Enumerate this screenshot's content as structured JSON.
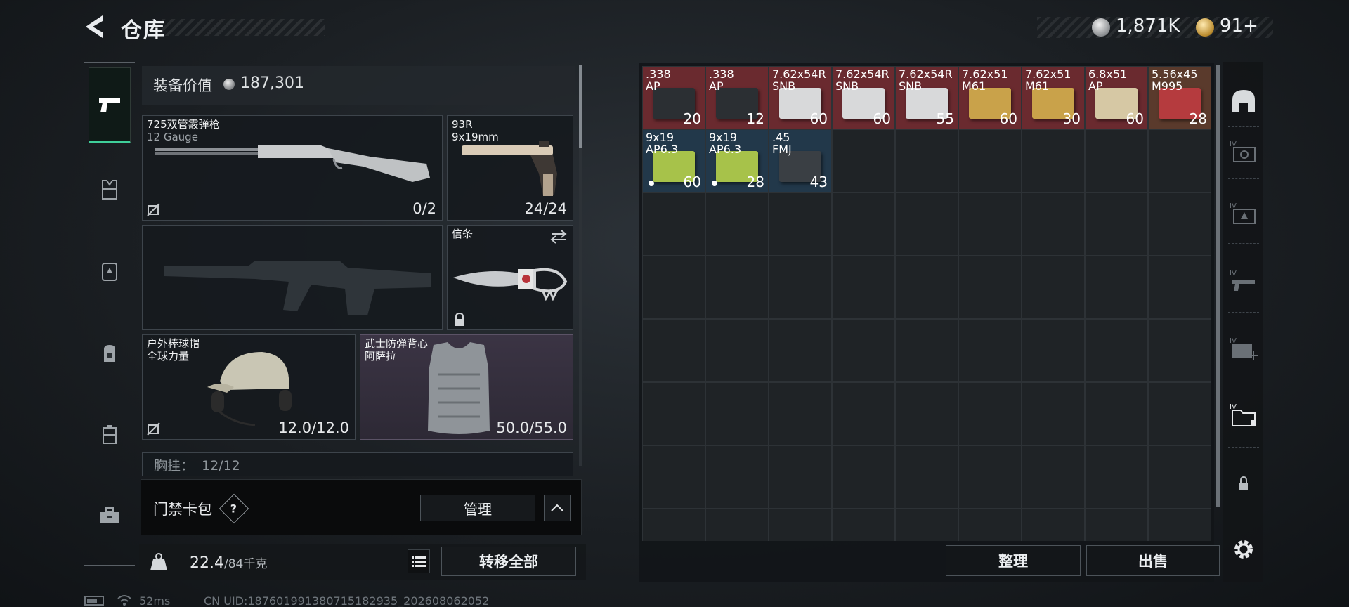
{
  "header": {
    "title": "仓库",
    "silver_amount": "1,871K",
    "gold_amount": "91+"
  },
  "loadout": {
    "equip_value_label": "装备价值",
    "equip_value": "187,301",
    "primary": {
      "name": "725双管霰弹枪",
      "caliber": "12 Gauge",
      "ammo": "0/2"
    },
    "sidearm": {
      "name": "93R",
      "caliber": "9x19mm",
      "ammo": "24/24"
    },
    "melee": {
      "name": "信条"
    },
    "helmet": {
      "name": "户外棒球帽",
      "brand": "全球力量",
      "durability": "12.0/12.0"
    },
    "armor": {
      "name": "武士防弹背心",
      "brand": "阿萨拉",
      "durability": "50.0/55.0"
    },
    "chest_rig": {
      "label": "胸挂：",
      "value": "12/12"
    }
  },
  "keycard": {
    "label": "门禁卡包",
    "help": "?",
    "manage_label": "管理"
  },
  "weight": {
    "current": "22.4",
    "max": "/84千克",
    "transfer_all_label": "转移全部"
  },
  "storage": {
    "items": [
      {
        "name": ".338\nAP",
        "count": "20",
        "bg": "#6a2a2f",
        "box": "#2b2f33",
        "dot": false
      },
      {
        "name": ".338\nAP",
        "count": "12",
        "bg": "#6a2a2f",
        "box": "#2b2f33",
        "dot": false
      },
      {
        "name": "7.62x54R\nSNB",
        "count": "60",
        "bg": "#6a2a2f",
        "box": "#d8d9da",
        "dot": false
      },
      {
        "name": "7.62x54R\nSNB",
        "count": "60",
        "bg": "#6a2a2f",
        "box": "#d8d9da",
        "dot": false
      },
      {
        "name": "7.62x54R\nSNB",
        "count": "55",
        "bg": "#6a2a2f",
        "box": "#d8d9da",
        "dot": false
      },
      {
        "name": "7.62x51\nM61",
        "count": "60",
        "bg": "#6a2a2f",
        "box": "#c9a24a",
        "dot": false
      },
      {
        "name": "7.62x51\nM61",
        "count": "30",
        "bg": "#6a2a2f",
        "box": "#c9a24a",
        "dot": false
      },
      {
        "name": "6.8x51\nAP",
        "count": "60",
        "bg": "#6a2a2f",
        "box": "#d6c8a4",
        "dot": false
      },
      {
        "name": "5.56x45\nM995",
        "count": "28",
        "bg": "#5a3a2c",
        "box": "#b53b3e",
        "dot": false
      },
      {
        "name": "9x19\nAP6.3",
        "count": "60",
        "bg": "#22384a",
        "box": "#a7c24a",
        "dot": true
      },
      {
        "name": "9x19\nAP6.3",
        "count": "28",
        "bg": "#22384a",
        "box": "#a7c24a",
        "dot": true
      },
      {
        "name": ".45\nFMJ",
        "count": "43",
        "bg": "#22384a",
        "box": "#3a3f44",
        "dot": false
      }
    ],
    "sort_label": "整理",
    "sell_label": "出售"
  },
  "status_bar": {
    "ping": "52ms",
    "uid": "CN UID:18760199138071518293​5_202608062052"
  },
  "colors": {
    "accent": "#3fcf9a",
    "rare_red": "#6a2a2f",
    "uncommon_blue": "#22384a",
    "armor_purple": "#3b3444"
  }
}
